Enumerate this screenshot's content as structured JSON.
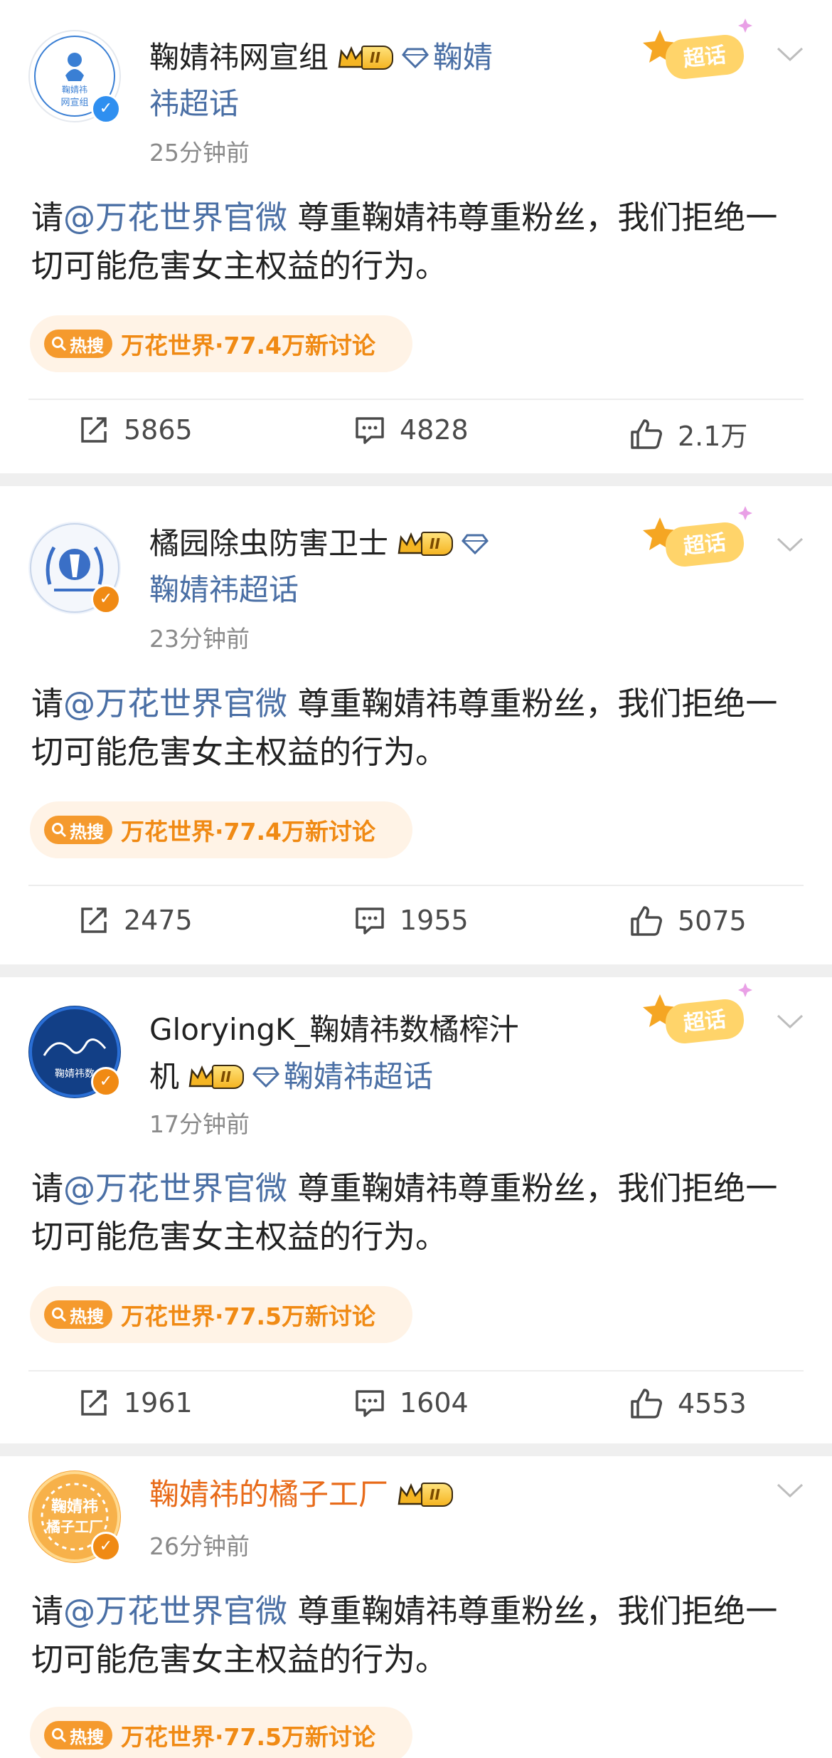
{
  "hot_tag_label": "热搜",
  "posts": [
    {
      "name": "鞠婧祎网宣组",
      "topic": "鞠婧祎超话",
      "level": "II",
      "time": "25分钟前",
      "text_before": "请",
      "mention": "@万花世界官微",
      "text_after": " 尊重鞠婧祎尊重粉丝，我们拒绝一切可能危害女主权益的行为。",
      "hot": "万花世界·77.4万新讨论",
      "avatar_text": [
        "鞠婧祎",
        "网宣组"
      ],
      "verified": "blue",
      "chaohua_label": "超话",
      "shares": "5865",
      "comments": "4828",
      "likes": "2.1万"
    },
    {
      "name": "橘园除虫防害卫士",
      "topic": "鞠婧祎超话",
      "level": "II",
      "time": "23分钟前",
      "text_before": "请",
      "mention": "@万花世界官微",
      "text_after": " 尊重鞠婧祎尊重粉丝，我们拒绝一切可能危害女主权益的行为。",
      "hot": "万花世界·77.4万新讨论",
      "verified": "orange",
      "chaohua_label": "超话",
      "shares": "2475",
      "comments": "1955",
      "likes": "5075"
    },
    {
      "name": "GloryingK_鞠婧祎数橘榨汁",
      "name_cont": "机",
      "topic": "鞠婧祎超话",
      "level": "II",
      "time": "17分钟前",
      "text_before": "请",
      "mention": "@万花世界官微",
      "text_after": " 尊重鞠婧祎尊重粉丝，我们拒绝一切可能危害女主权益的行为。",
      "hot": "万花世界·77.5万新讨论",
      "avatar_text": [
        "鞠婧祎数"
      ],
      "verified": "orange",
      "chaohua_label": "超话",
      "shares": "1961",
      "comments": "1604",
      "likes": "4553"
    },
    {
      "name": "鞠婧祎的橘子工厂",
      "level": "II",
      "time": "26分钟前",
      "text_before": "请",
      "mention": "@万花世界官微",
      "text_after": " 尊重鞠婧祎尊重粉丝，我们拒绝一切可能危害女主权益的行为。",
      "hot": "万花世界·77.5万新讨论",
      "avatar_text": [
        "鞠婧祎",
        "橘子工厂"
      ],
      "verified": "orange"
    }
  ]
}
